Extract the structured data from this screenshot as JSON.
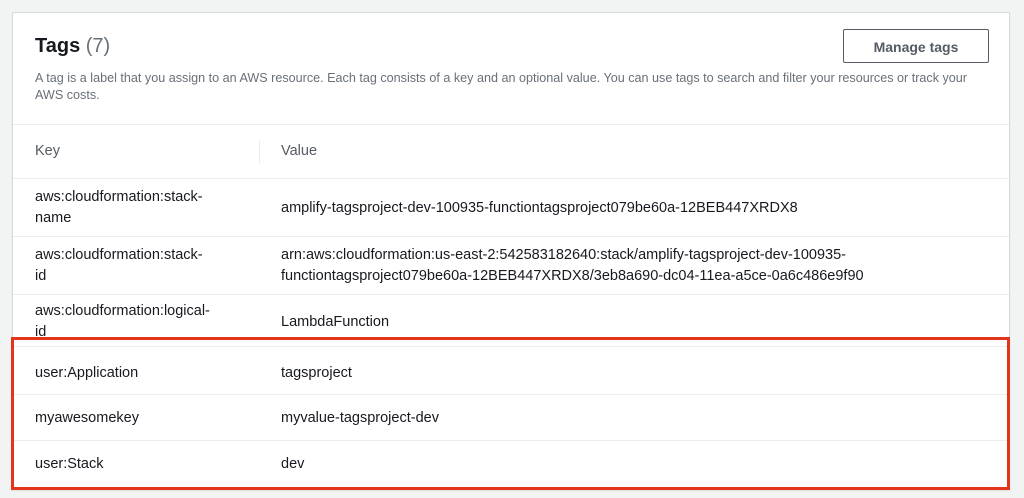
{
  "panel": {
    "title": "Tags",
    "count": "(7)",
    "description": "A tag is a label that you assign to an AWS resource. Each tag consists of a key and an optional value. You can use tags to search and filter your resources or track your AWS costs.",
    "manage_button_label": "Manage tags"
  },
  "table": {
    "columns": {
      "key": "Key",
      "value": "Value"
    },
    "rows": [
      {
        "key_lines": [
          "aws:cloudformation:stack-",
          "name"
        ],
        "value_lines": [
          "amplify-tagsproject-dev-100935-functiontagsproject079be60a-12BEB447XRDX8"
        ]
      },
      {
        "key_lines": [
          "aws:cloudformation:stack-",
          "id"
        ],
        "value_lines": [
          "arn:aws:cloudformation:us-east-2:542583182640:stack/amplify-tagsproject-dev-100935-",
          "functiontagsproject079be60a-12BEB447XRDX8/3eb8a690-dc04-11ea-a5ce-0a6c486e9f90"
        ]
      },
      {
        "key_lines": [
          "aws:cloudformation:logical-",
          "id"
        ],
        "value_lines": [
          "LambdaFunction"
        ]
      },
      {
        "key_lines": [
          "user:Application"
        ],
        "value_lines": [
          "tagsproject"
        ]
      },
      {
        "key_lines": [
          "myawesomekey"
        ],
        "value_lines": [
          "myvalue-tagsproject-dev"
        ]
      },
      {
        "key_lines": [
          "user:Stack"
        ],
        "value_lines": [
          "dev"
        ]
      }
    ]
  },
  "colors": {
    "highlight_border": "#e3341c",
    "text": "#16191f",
    "muted_text": "#687078"
  }
}
